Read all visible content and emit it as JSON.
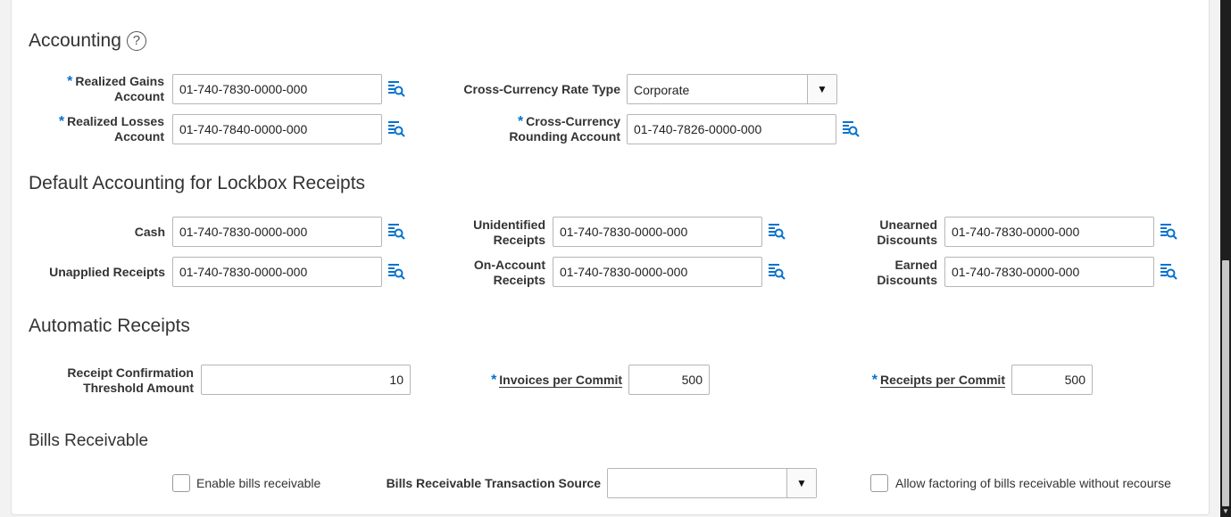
{
  "accounting": {
    "title": "Accounting",
    "help_icon": "question-circle-icon",
    "realized_gains": {
      "label_1": "Realized Gains",
      "label_2": "Account",
      "value": "01-740-7830-0000-000"
    },
    "realized_losses": {
      "label_1": "Realized Losses",
      "label_2": "Account",
      "value": "01-740-7840-0000-000"
    },
    "rate_type": {
      "label": "Cross-Currency Rate Type",
      "value": "Corporate"
    },
    "rounding": {
      "label_1": "Cross-Currency",
      "label_2": "Rounding Account",
      "value": "01-740-7826-0000-000"
    }
  },
  "lockbox": {
    "title": "Default Accounting for Lockbox Receipts",
    "cash": {
      "label": "Cash",
      "value": "01-740-7830-0000-000"
    },
    "unapplied": {
      "label": "Unapplied Receipts",
      "value": "01-740-7830-0000-000"
    },
    "unidentified": {
      "label_1": "Unidentified",
      "label_2": "Receipts",
      "value": "01-740-7830-0000-000"
    },
    "on_account": {
      "label_1": "On-Account",
      "label_2": "Receipts",
      "value": "01-740-7830-0000-000"
    },
    "unearned": {
      "label_1": "Unearned",
      "label_2": "Discounts",
      "value": "01-740-7830-0000-000"
    },
    "earned": {
      "label_1": "Earned",
      "label_2": "Discounts",
      "value": "01-740-7830-0000-000"
    }
  },
  "automatic": {
    "title": "Automatic Receipts",
    "threshold": {
      "label_1": "Receipt Confirmation",
      "label_2": "Threshold Amount",
      "value": "10"
    },
    "invoices": {
      "label": "Invoices per Commit",
      "value": "500"
    },
    "receipts": {
      "label": "Receipts per Commit",
      "value": "500"
    }
  },
  "bills": {
    "title": "Bills Receivable",
    "enable": {
      "label": "Enable bills receivable",
      "checked": false
    },
    "source": {
      "label": "Bills Receivable Transaction Source",
      "value": ""
    },
    "factoring": {
      "label": "Allow factoring of bills receivable without recourse",
      "checked": false
    }
  },
  "required_marker": "*",
  "dropdown_glyph": "▼",
  "scroll_down_glyph": "▼",
  "colors": {
    "required": "#0572ce",
    "lov_icon": "#0572ce",
    "text": "#333333",
    "border": "#b6b6b6"
  }
}
